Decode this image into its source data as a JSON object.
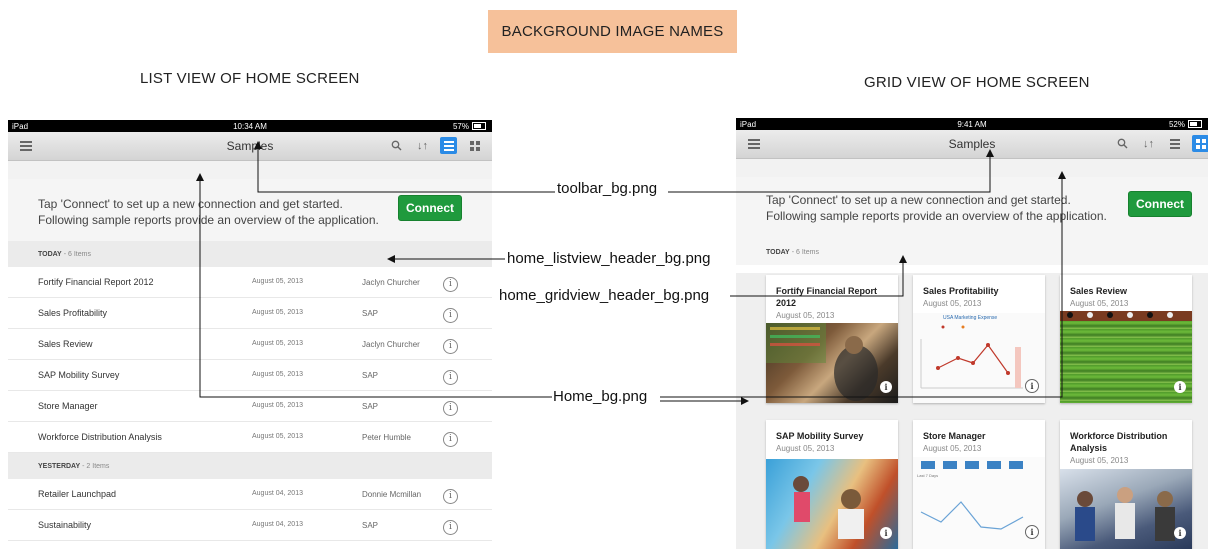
{
  "heading": "BACKGROUND IMAGE NAMES",
  "list_section_title": "LIST VIEW OF HOME SCREEN",
  "grid_section_title": "GRID VIEW OF HOME SCREEN",
  "list_screen": {
    "status": {
      "device": "iPad",
      "time": "10:34 AM",
      "battery": "57%"
    },
    "toolbar_title": "Samples",
    "banner_line1": "Tap 'Connect' to set up a new connection and get started.",
    "banner_line2": "Following sample reports provide an overview of the application.",
    "connect_label": "Connect",
    "groups": [
      {
        "label": "TODAY",
        "count": "- 6 Items",
        "rows": [
          {
            "name": "Fortify Financial Report 2012",
            "date": "August 05, 2013",
            "owner": "Jaclyn  Churcher"
          },
          {
            "name": "Sales Profitability",
            "date": "August 05, 2013",
            "owner": "SAP"
          },
          {
            "name": "Sales Review",
            "date": "August 05, 2013",
            "owner": "Jaclyn  Churcher"
          },
          {
            "name": "SAP Mobility Survey",
            "date": "August 05, 2013",
            "owner": "SAP"
          },
          {
            "name": "Store Manager",
            "date": "August 05, 2013",
            "owner": "SAP"
          },
          {
            "name": "Workforce Distribution Analysis",
            "date": "August 05, 2013",
            "owner": "Peter  Humble"
          }
        ]
      },
      {
        "label": "YESTERDAY",
        "count": "- 2 Items",
        "rows": [
          {
            "name": "Retailer Launchpad",
            "date": "August 04, 2013",
            "owner": "Donnie Mcmillan"
          },
          {
            "name": "Sustainability",
            "date": "August 04, 2013",
            "owner": "SAP"
          }
        ]
      }
    ]
  },
  "grid_screen": {
    "status": {
      "device": "iPad",
      "time": "9:41 AM",
      "battery": "52%"
    },
    "toolbar_title": "Samples",
    "banner_line1": "Tap 'Connect' to set up a new connection and get started.",
    "banner_line2": "Following sample reports provide an overview of the application.",
    "connect_label": "Connect",
    "group_label": "TODAY",
    "group_count": "- 6 Items",
    "tiles": [
      {
        "title": "Fortify Financial Report 2012",
        "date": "August 05, 2013"
      },
      {
        "title": "Sales Profitability",
        "date": "August 05, 2013"
      },
      {
        "title": "Sales Review",
        "date": "August 05, 2013"
      },
      {
        "title": "SAP Mobility Survey",
        "date": "August 05, 2013"
      },
      {
        "title": "Store Manager",
        "date": "August 05, 2013"
      },
      {
        "title": "Workforce Distribution Analysis",
        "date": "August 05, 2013"
      }
    ],
    "chart_caption": "USA Marketing Expense",
    "store_caption": "Last 7 Days"
  },
  "annotations": {
    "toolbar": "toolbar_bg.png",
    "list_header": "home_listview_header_bg.png",
    "grid_header": "home_gridview_header_bg.png",
    "home": "Home_bg.png"
  },
  "icons": {
    "menu": "hamburger-icon",
    "search": "search-icon",
    "sort": "sort-icon",
    "list": "list-view-icon",
    "grid": "grid-view-icon",
    "info": "info-icon"
  },
  "colors": {
    "heading_badge": "#f6c19a",
    "connect_button": "#1f9a3d",
    "active_view_toggle": "#2b8be6"
  }
}
